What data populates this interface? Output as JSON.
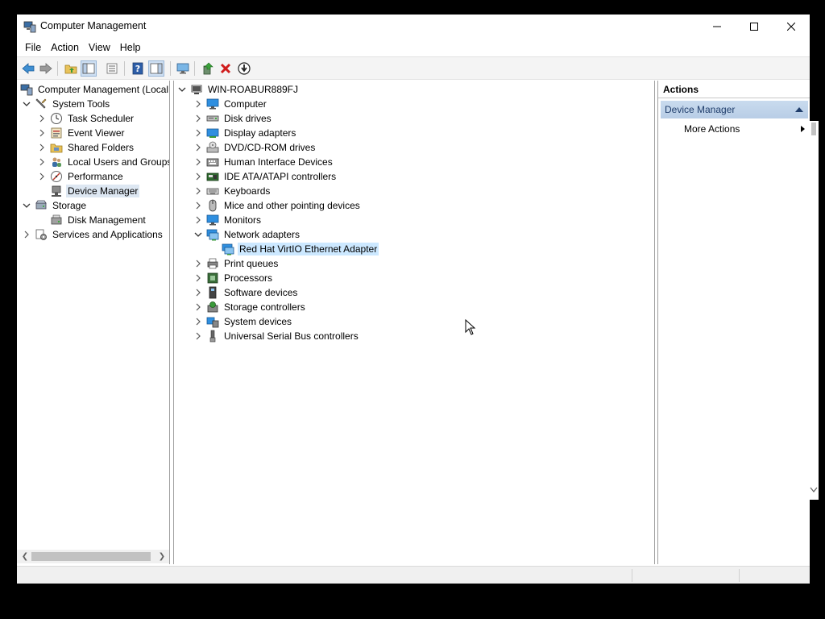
{
  "window": {
    "title": "Computer Management"
  },
  "menu": [
    "File",
    "Action",
    "View",
    "Help"
  ],
  "left_tree": [
    {
      "label": "Computer Management (Local",
      "icon": "computer-management-icon",
      "chev": ""
    },
    {
      "label": "System Tools",
      "icon": "tools-icon",
      "chev": "down"
    },
    {
      "label": "Task Scheduler",
      "icon": "clock-icon",
      "chev": "right"
    },
    {
      "label": "Event Viewer",
      "icon": "event-viewer-icon",
      "chev": "right"
    },
    {
      "label": "Shared Folders",
      "icon": "shared-folder-icon",
      "chev": "right"
    },
    {
      "label": "Local Users and Groups",
      "icon": "users-icon",
      "chev": "right"
    },
    {
      "label": "Performance",
      "icon": "performance-icon",
      "chev": "right"
    },
    {
      "label": "Device Manager",
      "icon": "device-manager-icon",
      "chev": ""
    },
    {
      "label": "Storage",
      "icon": "storage-icon",
      "chev": "down"
    },
    {
      "label": "Disk Management",
      "icon": "disk-management-icon",
      "chev": ""
    },
    {
      "label": "Services and Applications",
      "icon": "services-icon",
      "chev": "right"
    }
  ],
  "device_tree": {
    "root": "WIN-ROABUR889FJ",
    "categories": [
      {
        "label": "Computer",
        "icon": "monitor-icon",
        "chev": "right"
      },
      {
        "label": "Disk drives",
        "icon": "disk-drive-icon",
        "chev": "right"
      },
      {
        "label": "Display adapters",
        "icon": "display-adapter-icon",
        "chev": "right"
      },
      {
        "label": "DVD/CD-ROM drives",
        "icon": "dvd-icon",
        "chev": "right"
      },
      {
        "label": "Human Interface Devices",
        "icon": "hid-icon",
        "chev": "right"
      },
      {
        "label": "IDE ATA/ATAPI controllers",
        "icon": "ide-icon",
        "chev": "right"
      },
      {
        "label": "Keyboards",
        "icon": "keyboard-icon",
        "chev": "right"
      },
      {
        "label": "Mice and other pointing devices",
        "icon": "mouse-icon",
        "chev": "right"
      },
      {
        "label": "Monitors",
        "icon": "monitor-icon",
        "chev": "right"
      },
      {
        "label": "Network adapters",
        "icon": "network-icon",
        "chev": "down"
      },
      {
        "label": "Red Hat VirtIO Ethernet Adapter",
        "icon": "network-icon",
        "chev": "",
        "child": true
      },
      {
        "label": "Print queues",
        "icon": "printer-icon",
        "chev": "right"
      },
      {
        "label": "Processors",
        "icon": "processor-icon",
        "chev": "right"
      },
      {
        "label": "Software devices",
        "icon": "software-device-icon",
        "chev": "right"
      },
      {
        "label": "Storage controllers",
        "icon": "storage-controller-icon",
        "chev": "right"
      },
      {
        "label": "System devices",
        "icon": "system-device-icon",
        "chev": "right"
      },
      {
        "label": "Universal Serial Bus controllers",
        "icon": "usb-icon",
        "chev": "right"
      }
    ]
  },
  "actions": {
    "header": "Actions",
    "group": "Device Manager",
    "more": "More Actions"
  },
  "colors": {
    "selection": "#cce8ff",
    "tree_selected": "#dde7f2",
    "actions_group": "#c9dbee"
  }
}
